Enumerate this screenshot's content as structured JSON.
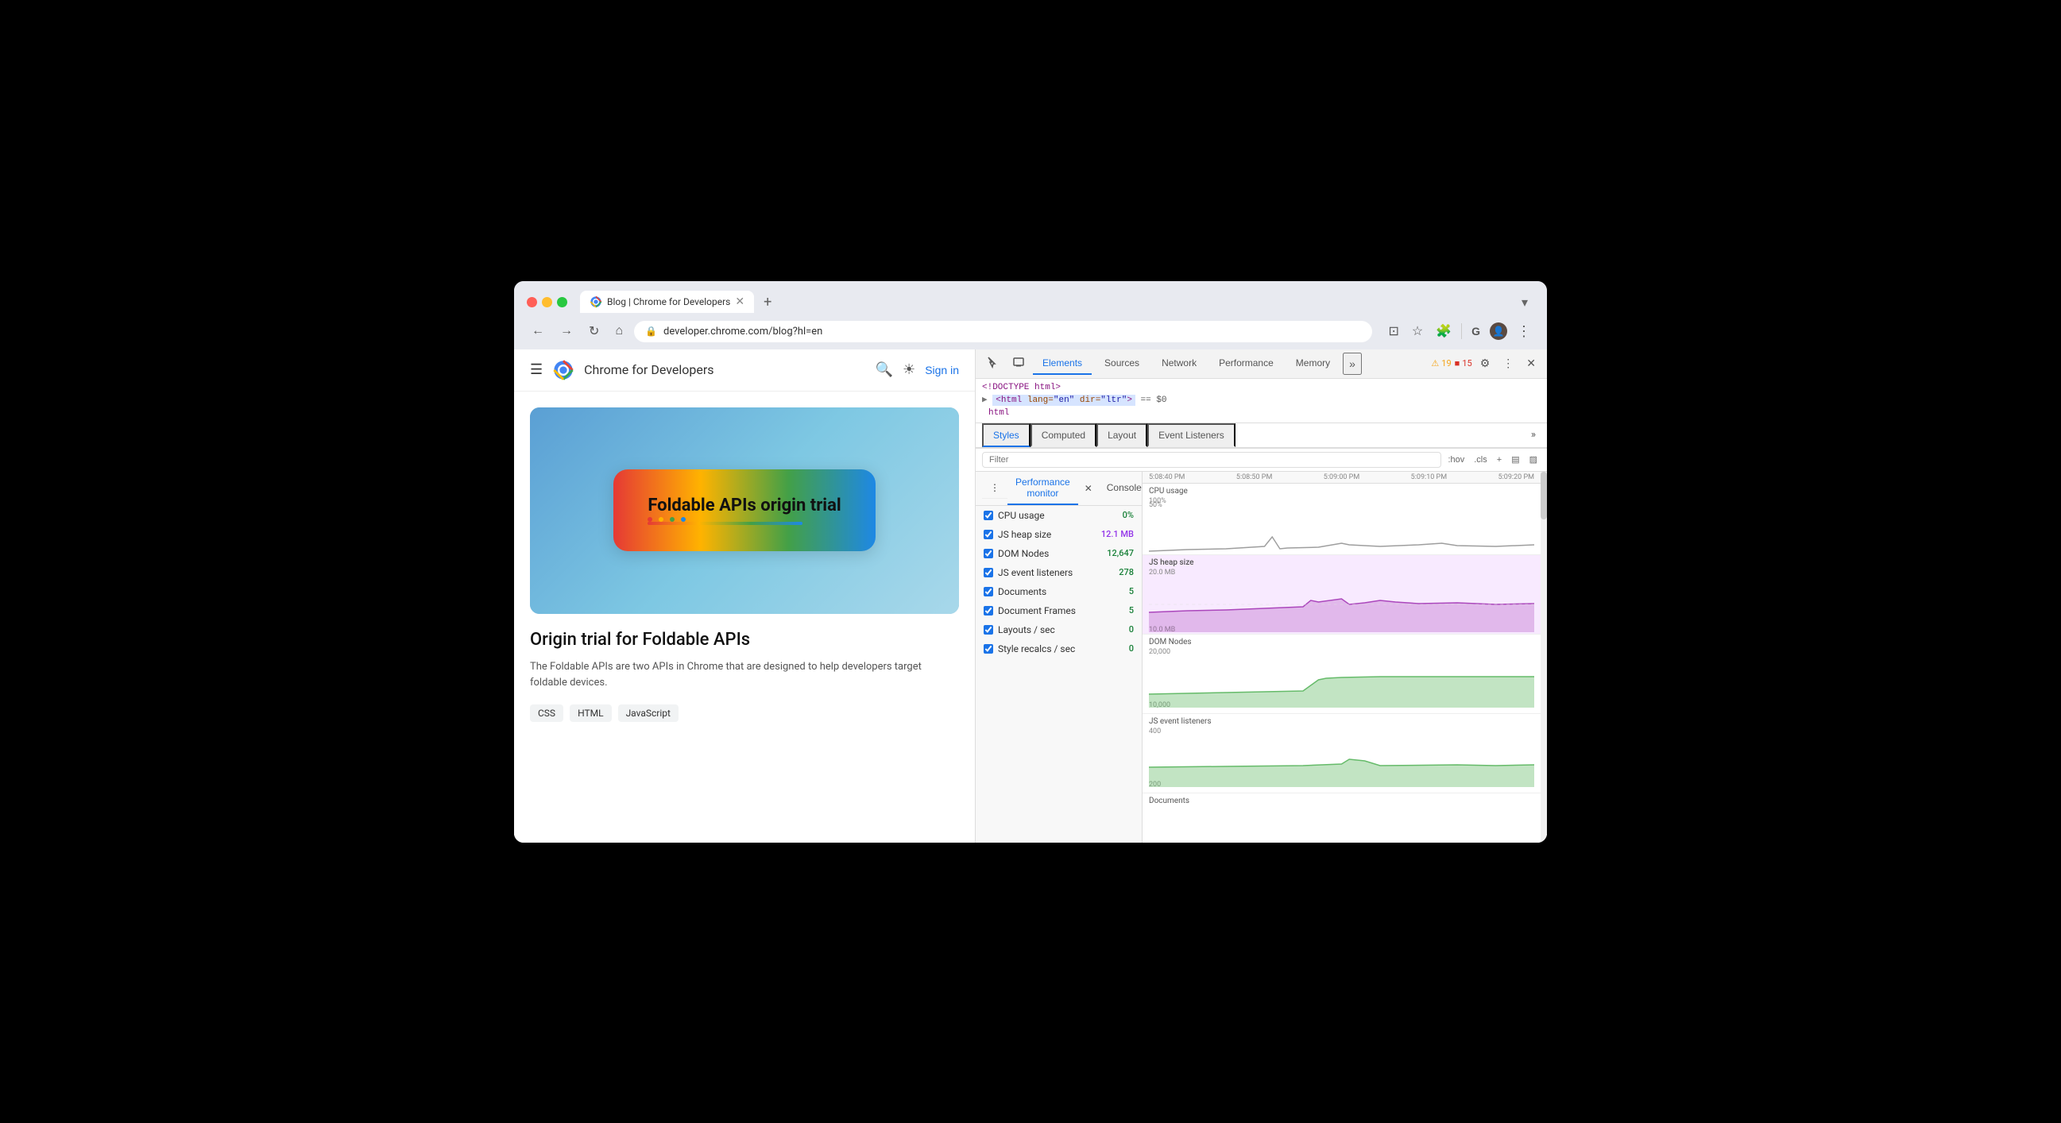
{
  "browser": {
    "tab_title": "Blog | Chrome for Developers",
    "tab_favicon": "chrome",
    "address": "developer.chrome.com/blog?hl=en",
    "new_tab_label": "+",
    "tab_menu_label": "▾"
  },
  "nav": {
    "back_label": "←",
    "forward_label": "→",
    "reload_label": "↻",
    "home_label": "⌂",
    "address_icon": "🔒",
    "cast_label": "⊡",
    "bookmark_label": "☆",
    "extension_label": "🧩",
    "google_label": "G",
    "profile_label": "👤",
    "menu_label": "⋮"
  },
  "website": {
    "header": {
      "hamburger_label": "☰",
      "site_title": "Chrome for Developers",
      "search_label": "🔍",
      "theme_label": "☀",
      "sign_in_label": "Sign in"
    },
    "blog_post": {
      "card_title": "Foldable APIs origin trial",
      "post_title": "Origin trial for Foldable APIs",
      "post_desc": "The Foldable APIs are two APIs in Chrome that are designed to help developers target foldable devices.",
      "tags": [
        "CSS",
        "HTML",
        "JavaScript"
      ]
    }
  },
  "devtools": {
    "toolbar": {
      "inspect_label": "⊹",
      "device_label": "▭",
      "tabs": [
        "Elements",
        "Sources",
        "Network",
        "Performance",
        "Memory"
      ],
      "active_tab": "Elements",
      "overflow_label": "»",
      "warning_icon": "⚠",
      "warning_count": "19",
      "error_icon": "■",
      "error_count": "15",
      "settings_label": "⚙",
      "more_label": "⋮",
      "close_label": "✕"
    },
    "elements": {
      "doctype_line": "<!DOCTYPE html>",
      "html_line": "<html lang=\"en\" dir=\"ltr\"> == $0",
      "html_tag": "html"
    },
    "styles": {
      "tabs": [
        "Styles",
        "Computed",
        "Layout",
        "Event Listeners"
      ],
      "active_tab": "Styles",
      "overflow_label": "»",
      "filter_placeholder": "Filter",
      "hov_label": ":hov",
      "cls_label": ".cls",
      "add_label": "+",
      "layout_label": "▤",
      "split_label": "▨"
    },
    "perf_monitor": {
      "title": "Performance monitor",
      "close_label": "✕",
      "more_label": "⋮",
      "console_tab": "Console",
      "metrics": [
        {
          "label": "CPU usage",
          "value": "0%",
          "color": "green",
          "checked": true
        },
        {
          "label": "JS heap size",
          "value": "12.1 MB",
          "color": "purple",
          "checked": true
        },
        {
          "label": "DOM Nodes",
          "value": "12,647",
          "color": "green",
          "checked": true
        },
        {
          "label": "JS event listeners",
          "value": "278",
          "color": "green",
          "checked": true
        },
        {
          "label": "Documents",
          "value": "5",
          "color": "green",
          "checked": true
        },
        {
          "label": "Document Frames",
          "value": "5",
          "color": "green",
          "checked": true
        },
        {
          "label": "Layouts / sec",
          "value": "0",
          "color": "green",
          "checked": true
        },
        {
          "label": "Style recalcs / sec",
          "value": "0",
          "color": "green",
          "checked": true
        }
      ],
      "time_labels": [
        "5:08:40 PM",
        "5:08:50 PM",
        "5:09:00 PM",
        "5:09:10 PM",
        "5:09:20 PM"
      ],
      "charts": [
        {
          "label": "CPU usage",
          "sublabel": "100%",
          "sublabel2": "50%",
          "color": "#9e9e9e",
          "fill": "rgba(158,158,158,0.3)",
          "type": "line"
        },
        {
          "label": "JS heap size",
          "sublabel": "20.0 MB",
          "sublabel2": "10.0 MB",
          "color": "#ab47bc",
          "fill": "rgba(171,71,188,0.3)",
          "type": "area"
        },
        {
          "label": "DOM Nodes",
          "sublabel": "20,000",
          "sublabel2": "10,000",
          "color": "#66bb6a",
          "fill": "rgba(102,187,106,0.3)",
          "type": "area"
        },
        {
          "label": "JS event listeners",
          "sublabel": "400",
          "sublabel2": "200",
          "color": "#66bb6a",
          "fill": "rgba(102,187,106,0.3)",
          "type": "area"
        },
        {
          "label": "Documents",
          "sublabel": "",
          "sublabel2": "",
          "color": "#66bb6a",
          "fill": "rgba(102,187,106,0.3)",
          "type": "area"
        }
      ]
    }
  }
}
